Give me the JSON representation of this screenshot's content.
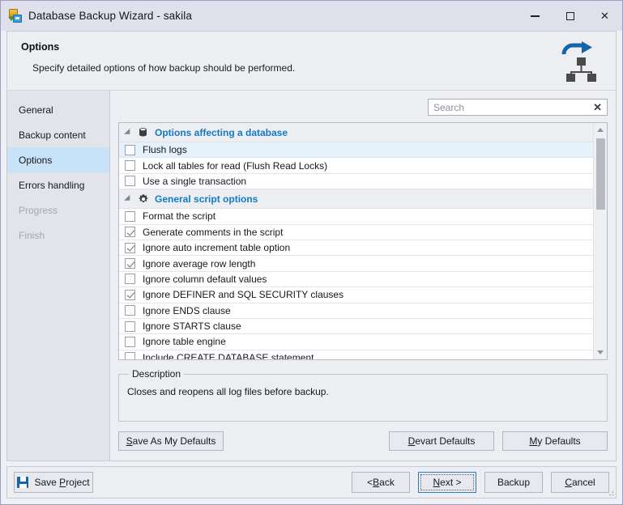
{
  "window": {
    "title": "Database Backup Wizard - sakila",
    "app_icon": "database-save-icon",
    "minimize_label": "Minimize",
    "maximize_label": "Maximize",
    "close_label": "Close",
    "close_glyph": "✕"
  },
  "header": {
    "title": "Options",
    "subtitle": "Specify detailed options of how backup should be performed.",
    "icon": "backup-hierarchy-icon",
    "accent_blue": "#1565a8",
    "icon_dark": "#4a4a4a"
  },
  "sidebar": {
    "items": [
      {
        "label": "General",
        "state": "enabled"
      },
      {
        "label": "Backup content",
        "state": "enabled"
      },
      {
        "label": "Options",
        "state": "active"
      },
      {
        "label": "Errors handling",
        "state": "enabled"
      },
      {
        "label": "Progress",
        "state": "disabled"
      },
      {
        "label": "Finish",
        "state": "disabled"
      }
    ],
    "active_color": "#c8e3f8"
  },
  "search": {
    "placeholder": "Search",
    "value": "",
    "clear_glyph": "✕",
    "clear_icon": "clear-search-icon",
    "search_icon": "search-input"
  },
  "options_list": {
    "group_label_color": "#1479c4",
    "selected_row_color": "#e5f1fb",
    "groups": [
      {
        "label": "Options affecting a database",
        "icon": "database-icon",
        "expanded": true,
        "items": [
          {
            "label": "Flush logs",
            "checked": false,
            "selected": true
          },
          {
            "label": "Lock all tables for read (Flush Read Locks)",
            "checked": false,
            "selected": false
          },
          {
            "label": "Use a single transaction",
            "checked": false,
            "selected": false
          }
        ]
      },
      {
        "label": "General script options",
        "icon": "gear-icon",
        "expanded": true,
        "items": [
          {
            "label": "Format the script",
            "checked": false,
            "selected": false
          },
          {
            "label": "Generate comments in the script",
            "checked": true,
            "selected": false
          },
          {
            "label": "Ignore auto increment table option",
            "checked": true,
            "selected": false
          },
          {
            "label": "Ignore average row length",
            "checked": true,
            "selected": false
          },
          {
            "label": "Ignore column default values",
            "checked": false,
            "selected": false
          },
          {
            "label": "Ignore DEFINER and SQL SECURITY clauses",
            "checked": true,
            "selected": false
          },
          {
            "label": "Ignore ENDS clause",
            "checked": false,
            "selected": false
          },
          {
            "label": "Ignore STARTS clause",
            "checked": false,
            "selected": false
          },
          {
            "label": "Ignore table engine",
            "checked": false,
            "selected": false
          },
          {
            "label": "Include CREATE DATABASE statement",
            "checked": false,
            "selected": false
          }
        ]
      }
    ]
  },
  "description": {
    "legend": "Description",
    "text": "Closes and reopens all log files before backup."
  },
  "defaults": {
    "save_as_my_defaults": "Save As My Defaults",
    "save_as_my_defaults_mnemonic": "S",
    "devart_defaults": "Devart Defaults",
    "devart_defaults_mnemonic": "D",
    "my_defaults": "My Defaults",
    "my_defaults_mnemonic": "M"
  },
  "footer": {
    "save_project": "Save Project",
    "save_project_mnemonic": "P",
    "save_icon": "floppy-save-icon",
    "back": "< Back",
    "back_mnemonic": "B",
    "next": "Next >",
    "next_mnemonic": "N",
    "backup": "Backup",
    "backup_mnemonic": "u",
    "cancel": "Cancel",
    "cancel_mnemonic": "C",
    "default_button": "Next >"
  }
}
